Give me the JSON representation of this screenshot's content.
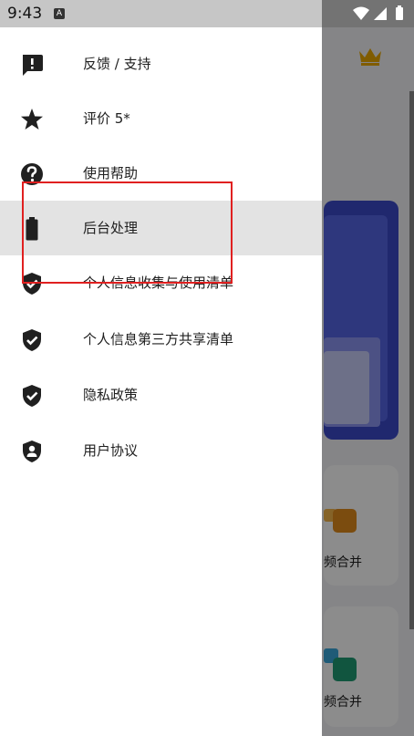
{
  "status_bar": {
    "time": "9:43",
    "notification_icon": "A"
  },
  "drawer": {
    "items": [
      {
        "icon": "feedback-icon",
        "label": "反馈 / 支持"
      },
      {
        "icon": "star-icon",
        "label": "评价 5*"
      },
      {
        "icon": "help-icon",
        "label": "使用帮助"
      },
      {
        "icon": "battery-icon",
        "label": "后台处理",
        "selected": true
      },
      {
        "icon": "shield-check-icon",
        "label": "个人信息收集与使用清单"
      },
      {
        "icon": "shield-check-icon",
        "label": "个人信息第三方共享清单"
      },
      {
        "icon": "shield-check-icon",
        "label": "隐私政策"
      },
      {
        "icon": "shield-user-icon",
        "label": "用户协议"
      }
    ]
  },
  "background": {
    "tile1_label": "频合并",
    "tile2_label": "频合并"
  },
  "colors": {
    "highlight": "#e02020",
    "crown": "#e9a800",
    "accent_blue": "#3b49c9"
  }
}
